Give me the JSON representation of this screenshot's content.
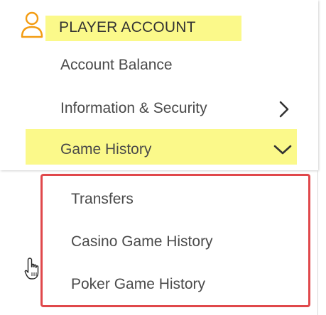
{
  "account_menu": {
    "header": {
      "title": "PLAYER ACCOUNT",
      "icon": "user-icon"
    },
    "items": [
      {
        "label": "Account Balance"
      },
      {
        "label": "Information & Security",
        "icon": "chevron-right-icon"
      },
      {
        "label": "Game History",
        "icon": "chevron-down-icon",
        "expanded": true
      }
    ],
    "submenu": {
      "items": [
        {
          "label": "Transfers"
        },
        {
          "label": "Casino Game History"
        },
        {
          "label": "Poker Game History"
        }
      ]
    }
  },
  "colors": {
    "highlight": "#fbf98a",
    "accent_orange": "#f39c12",
    "outline_red": "#e0484b",
    "text": "#4a4a4a"
  },
  "cursor": {
    "icon": "hand-pointer-icon"
  }
}
